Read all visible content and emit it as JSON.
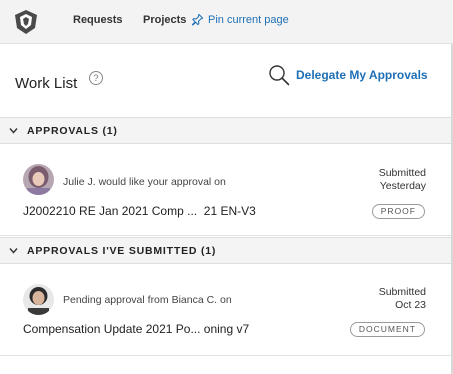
{
  "nav": {
    "requests": "Requests",
    "projects": "Projects",
    "pin": "Pin current page"
  },
  "header": {
    "title": "Work List",
    "help": "?",
    "delegate": "Delegate My Approvals"
  },
  "sections": [
    {
      "title": "APPROVALS (1)",
      "item": {
        "message": "Julie J. would like your approval on",
        "document": "J2002210 RE Jan 2021 Comp ...  21 EN-V3",
        "status_line1": "Submitted",
        "status_line2": "Yesterday",
        "badge": "PROOF"
      }
    },
    {
      "title": "APPROVALS I'VE SUBMITTED (1)",
      "item": {
        "message": "Pending approval from Bianca C. on",
        "document": "Compensation Update 2021 Po... oning v7",
        "status_line1": "Submitted",
        "status_line2": "Oct 23",
        "badge": "DOCUMENT"
      }
    }
  ],
  "colors": {
    "accent": "#1f6fb5",
    "section_bg": "#f4f4f4",
    "topbar_bg": "#f3f3f3"
  },
  "icons": {
    "logo": "lion-logo-icon",
    "pin": "pin-icon",
    "delegate": "magnifier-icon",
    "chevron": "chevron-down-icon",
    "help": "help-icon"
  }
}
